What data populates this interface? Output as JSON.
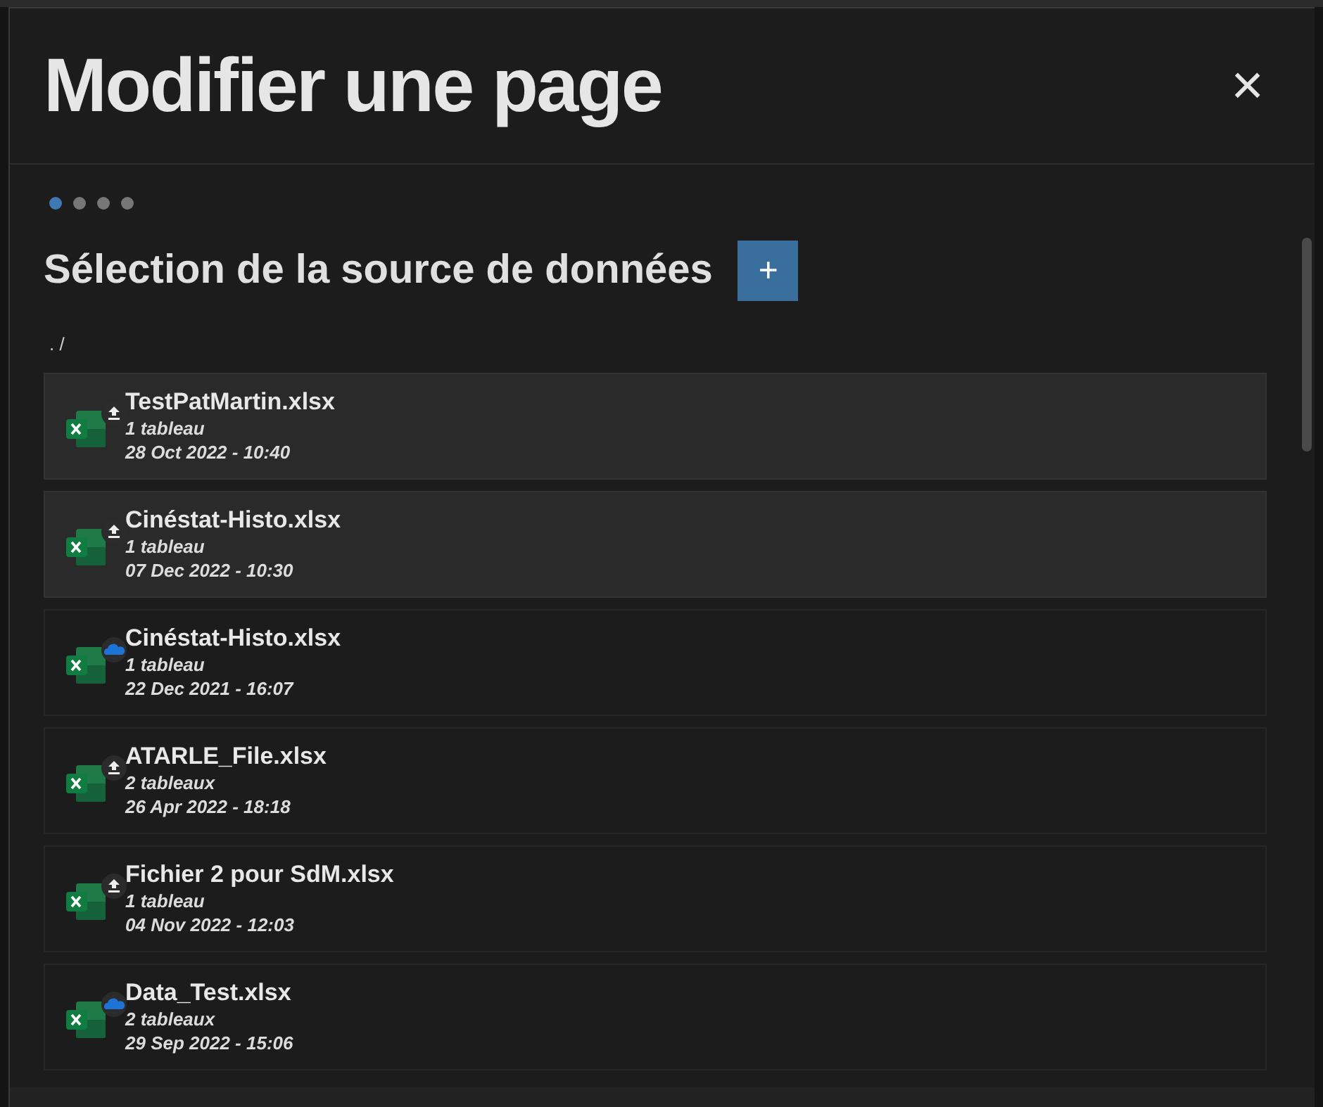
{
  "dialog": {
    "title": "Modifier une page",
    "close": "×"
  },
  "steps": [
    {
      "selected": true
    },
    {
      "selected": false
    },
    {
      "selected": false
    },
    {
      "selected": false
    }
  ],
  "section": {
    "title": "Sélection de la source de données",
    "add": "+"
  },
  "path": ". /",
  "files": [
    {
      "name": "TestPatMartin.xlsx",
      "tables": "1 tableau",
      "date": "28 Oct 2022 - 10:40",
      "kind": "upload",
      "selected": true
    },
    {
      "name": "Cinéstat-Histo.xlsx",
      "tables": "1 tableau",
      "date": "07 Dec 2022 - 10:30",
      "kind": "upload",
      "selected": true
    },
    {
      "name": "Cinéstat-Histo.xlsx",
      "tables": "1 tableau",
      "date": "22 Dec 2021 - 16:07",
      "kind": "cloud",
      "selected": false
    },
    {
      "name": "ATARLE_File.xlsx",
      "tables": "2 tableaux",
      "date": "26 Apr 2022 - 18:18",
      "kind": "upload",
      "selected": false
    },
    {
      "name": "Fichier 2 pour SdM.xlsx",
      "tables": "1 tableau",
      "date": "04 Nov 2022 - 12:03",
      "kind": "upload",
      "selected": false
    },
    {
      "name": "Data_Test.xlsx",
      "tables": "2 tableaux",
      "date": "29 Sep 2022 - 15:06",
      "kind": "cloud",
      "selected": false
    }
  ]
}
